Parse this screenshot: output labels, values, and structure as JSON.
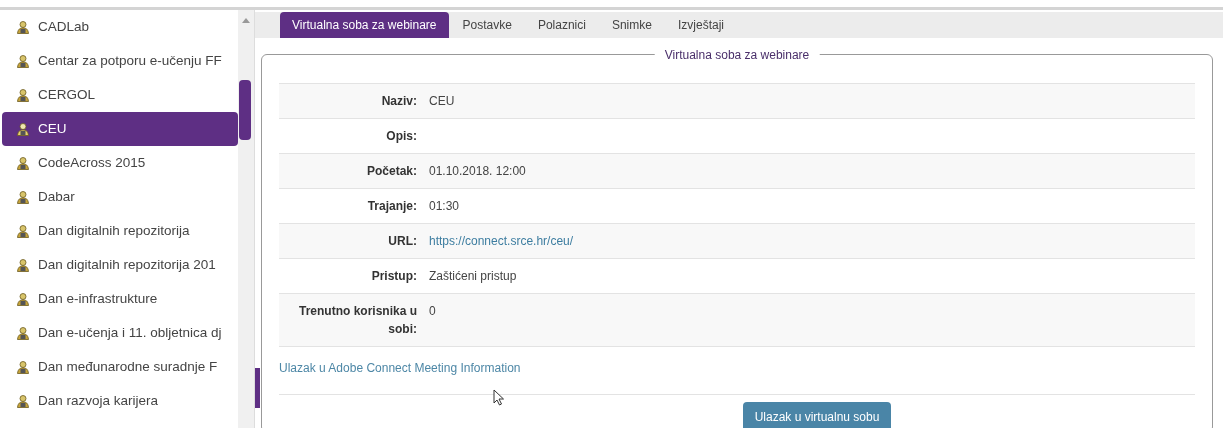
{
  "sidebar": {
    "items": [
      {
        "label": "CADLab",
        "selected": false
      },
      {
        "label": "Centar za potporu e-učenju FF",
        "selected": false
      },
      {
        "label": "CERGOL",
        "selected": false
      },
      {
        "label": "CEU",
        "selected": true
      },
      {
        "label": "CodeAcross 2015",
        "selected": false
      },
      {
        "label": "Dabar",
        "selected": false
      },
      {
        "label": "Dan digitalnih repozitorija",
        "selected": false
      },
      {
        "label": "Dan digitalnih repozitorija 201",
        "selected": false
      },
      {
        "label": "Dan e-infrastrukture",
        "selected": false
      },
      {
        "label": "Dan e-učenja i 11. obljetnica dj",
        "selected": false
      },
      {
        "label": "Dan međunarodne suradnje F",
        "selected": false
      },
      {
        "label": "Dan razvoja karijera",
        "selected": false
      }
    ]
  },
  "tabs": [
    {
      "label": "Virtualna soba za webinare",
      "selected": true
    },
    {
      "label": "Postavke",
      "selected": false
    },
    {
      "label": "Polaznici",
      "selected": false
    },
    {
      "label": "Snimke",
      "selected": false
    },
    {
      "label": "Izvještaji",
      "selected": false
    }
  ],
  "panel": {
    "legend": "Virtualna soba za webinare",
    "rows": [
      {
        "label": "Naziv:",
        "value": "CEU",
        "kind": "text"
      },
      {
        "label": "Opis:",
        "kind": "text"
      },
      {
        "label": "Početak:",
        "value": "01.10.2018. 12:00",
        "kind": "text"
      },
      {
        "label": "Trajanje:",
        "value": "01:30",
        "kind": "text"
      },
      {
        "label": "URL:",
        "value": "https://connect.srce.hr/ceu/",
        "kind": "link"
      },
      {
        "label": "Pristup:",
        "value": "Zaštićeni pristup",
        "kind": "text"
      },
      {
        "label": "Trenutno korisnika u sobi:",
        "value": "0",
        "kind": "text"
      }
    ],
    "info_link": "Ulazak u Adobe Connect Meeting Information",
    "button": "Ulazak u virtualnu sobu"
  }
}
